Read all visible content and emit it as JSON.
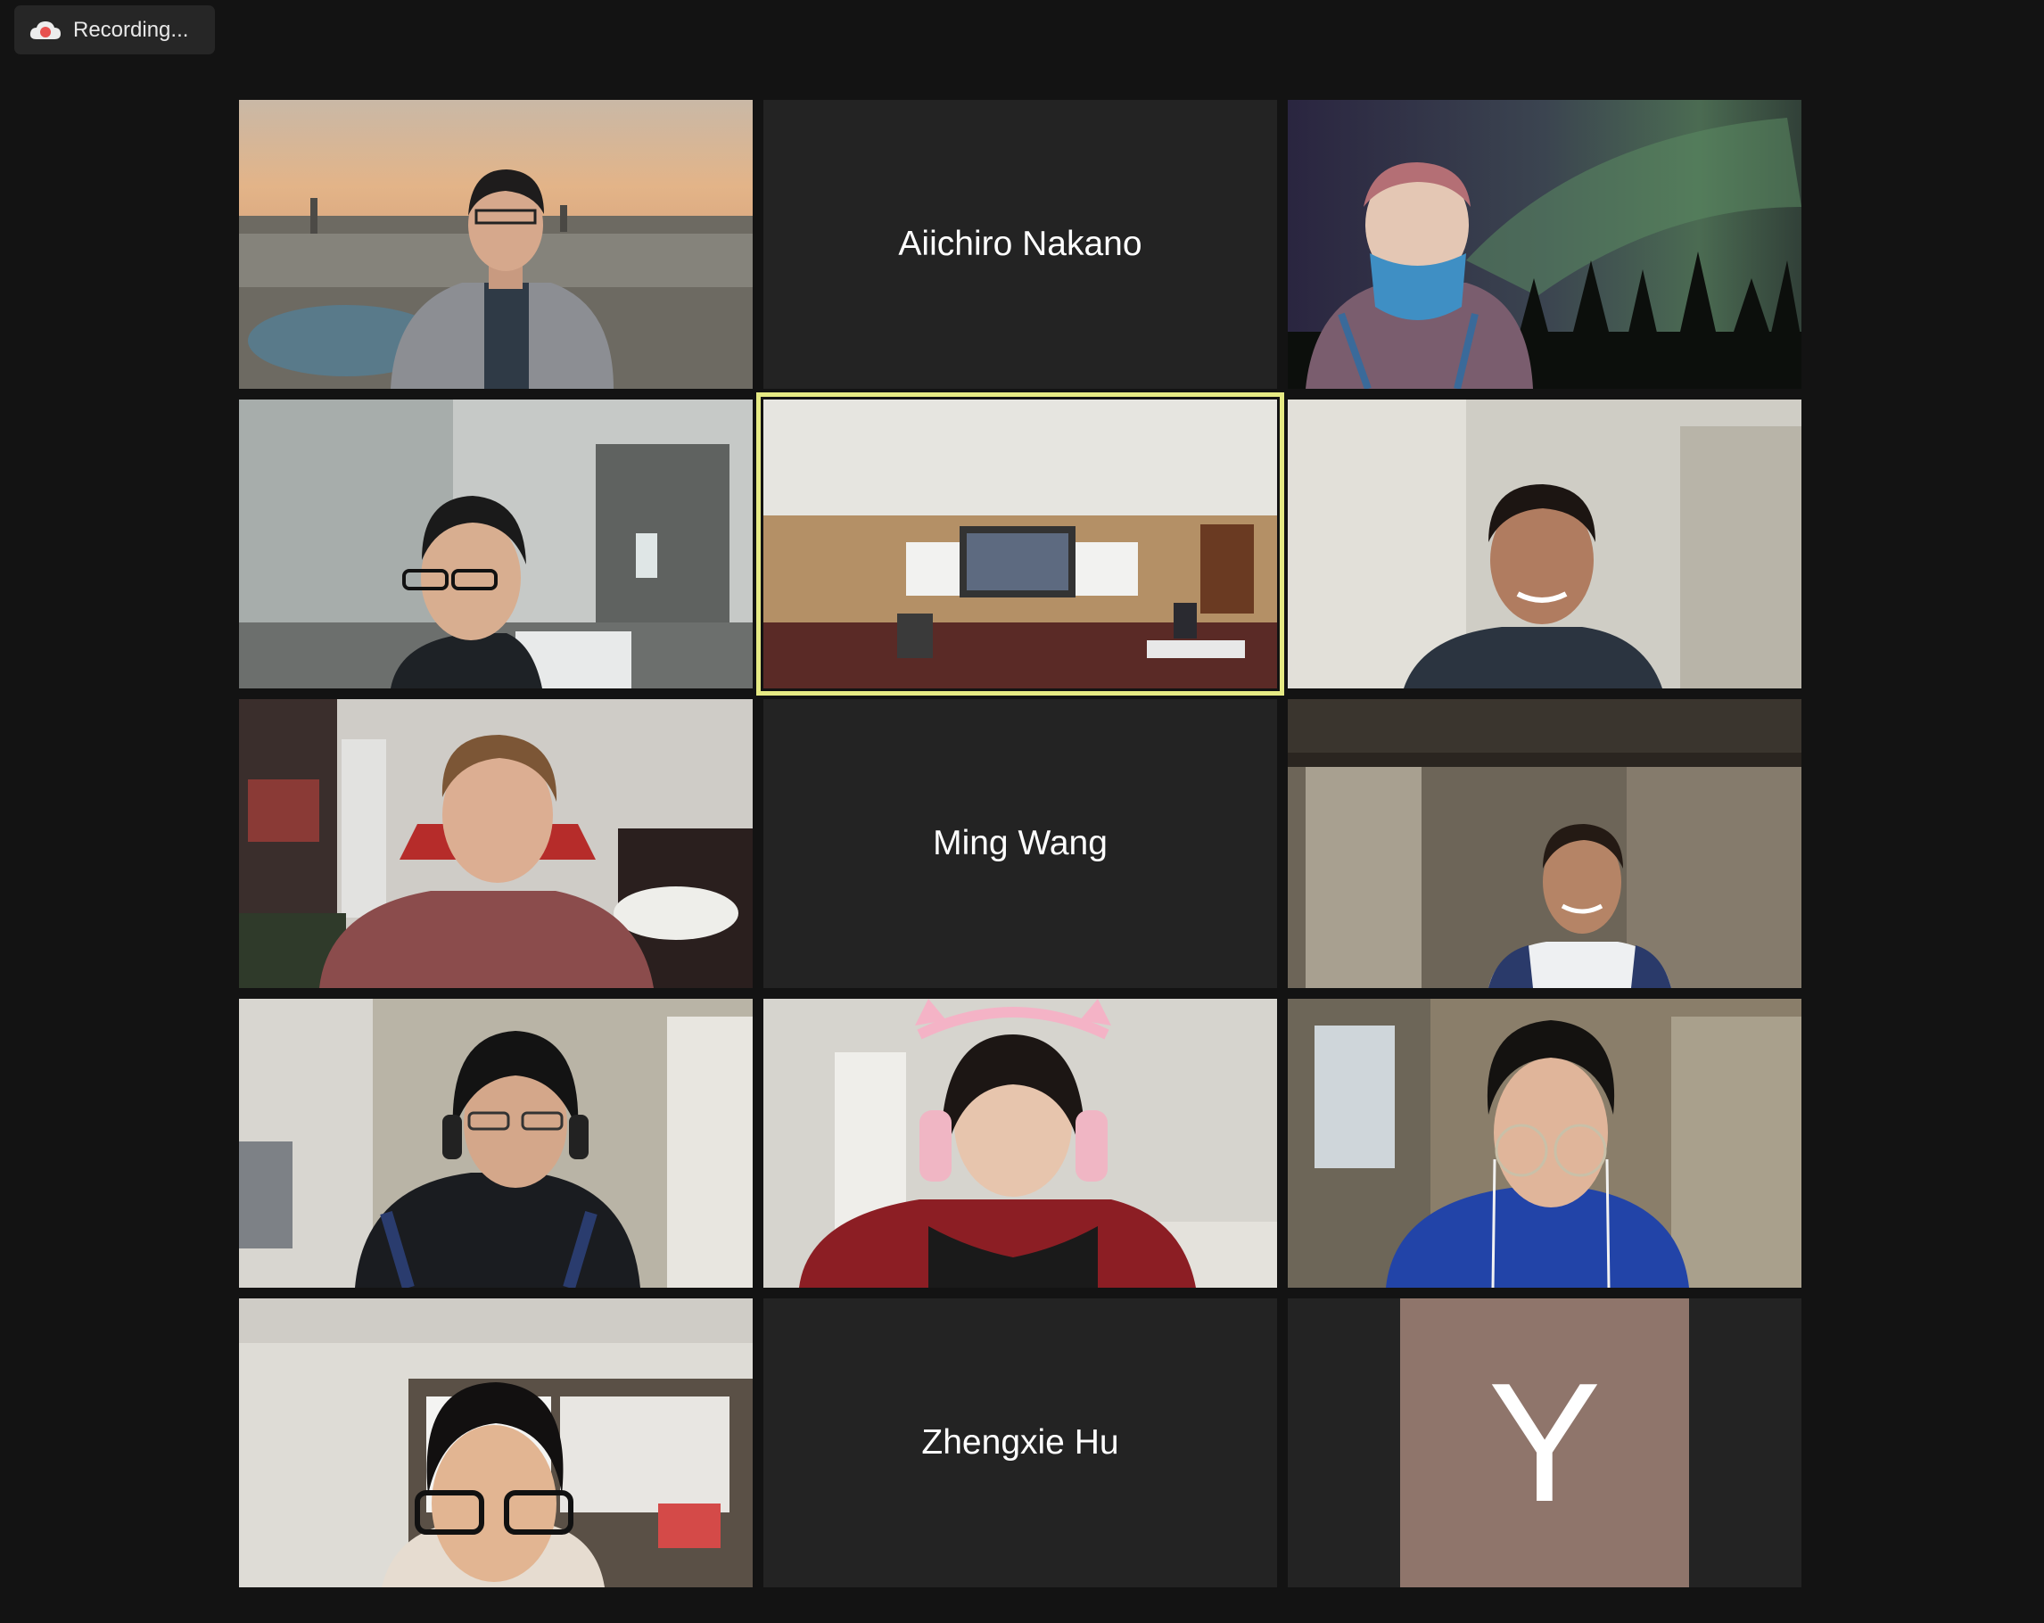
{
  "recording": {
    "label": "Recording...",
    "icon": "cloud-recording-icon",
    "color": "#e8514f"
  },
  "active_speaker_color": "#e6ea84",
  "avatar_color": "#8f756b",
  "participants": [
    {
      "type": "video",
      "scene": "city sunset virtual background"
    },
    {
      "type": "name",
      "name": "Aiichiro Nakano"
    },
    {
      "type": "video",
      "scene": "aurora virtual background, masked participant"
    },
    {
      "type": "video",
      "scene": "participant at home, glasses"
    },
    {
      "type": "video",
      "scene": "classroom with projector",
      "active": true
    },
    {
      "type": "video",
      "scene": "smiling participant, blurred room"
    },
    {
      "type": "video",
      "scene": "participant in gaming chair"
    },
    {
      "type": "name",
      "name": "Ming Wang"
    },
    {
      "type": "video",
      "scene": "participant under loft bed"
    },
    {
      "type": "video",
      "scene": "participant with headphones, blurred background"
    },
    {
      "type": "video",
      "scene": "participant with pink cat-ear headphones"
    },
    {
      "type": "video",
      "scene": "participant with glasses and earphones"
    },
    {
      "type": "video",
      "scene": "participant in office, glasses"
    },
    {
      "type": "name",
      "name": "Zhengxie Hu"
    },
    {
      "type": "avatar",
      "initial": "Y"
    }
  ]
}
